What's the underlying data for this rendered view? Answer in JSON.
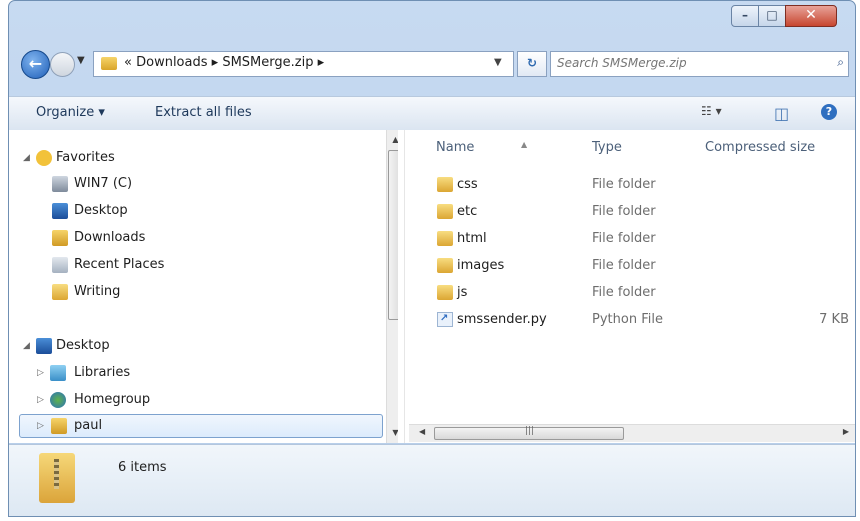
{
  "window": {
    "controls": {
      "minimize": "–",
      "maximize": "□",
      "close": "✕"
    }
  },
  "nav": {
    "back_icon": "back-arrow-icon",
    "address": {
      "prefix": "«",
      "segments": [
        "Downloads",
        "SMSMerge.zip"
      ],
      "separator": "▸"
    },
    "search_placeholder": "Search SMSMerge.zip"
  },
  "toolbar": {
    "organize_label": "Organize ▾",
    "extract_label": "Extract all files",
    "view_glyph": "☷ ▾",
    "pane_glyph": "◫",
    "help_glyph": "?"
  },
  "sidebar": {
    "favorites": {
      "label": "Favorites",
      "items": [
        {
          "label": "WIN7 (C)",
          "icon": "drive-icon"
        },
        {
          "label": "Desktop",
          "icon": "desktop-icon"
        },
        {
          "label": "Downloads",
          "icon": "downloads-icon"
        },
        {
          "label": "Recent Places",
          "icon": "recent-places-icon"
        },
        {
          "label": "Writing",
          "icon": "folder-icon"
        }
      ]
    },
    "desktop": {
      "label": "Desktop",
      "items": [
        {
          "label": "Libraries",
          "icon": "libraries-icon"
        },
        {
          "label": "Homegroup",
          "icon": "homegroup-icon"
        },
        {
          "label": "paul",
          "icon": "user-folder-icon",
          "selected": true
        }
      ]
    }
  },
  "files": {
    "columns": {
      "name": "Name",
      "type": "Type",
      "size": "Compressed size"
    },
    "rows": [
      {
        "name": "css",
        "type": "File folder",
        "size": ""
      },
      {
        "name": "etc",
        "type": "File folder",
        "size": ""
      },
      {
        "name": "html",
        "type": "File folder",
        "size": ""
      },
      {
        "name": "images",
        "type": "File folder",
        "size": ""
      },
      {
        "name": "js",
        "type": "File folder",
        "size": ""
      },
      {
        "name": "smssender.py",
        "type": "Python File",
        "size": "7 KB"
      }
    ]
  },
  "details": {
    "count": "6 items"
  }
}
